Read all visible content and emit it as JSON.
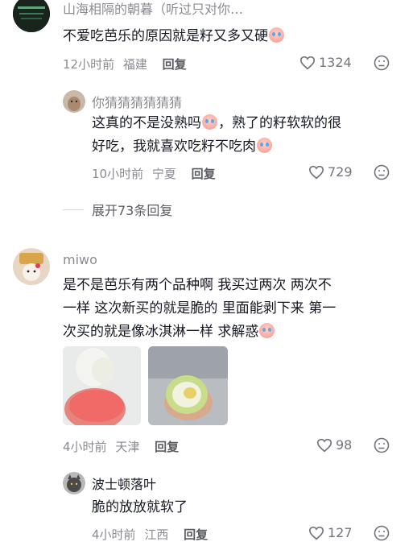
{
  "comments": [
    {
      "name": "山海相隔的朝暮（听过只对你…",
      "text_parts": [
        "不爱吃芭乐的原因就是籽又多又硬"
      ],
      "time": "12小时前",
      "location": "福建",
      "reply_label": "回复",
      "likes": "1324"
    },
    {
      "name": "你猜猜猜猜猜猜",
      "text_line1a": "这真的不是没熟吗",
      "text_line1b": "，熟了的籽软软的很",
      "text_line2": "好吃，我就喜欢吃籽不吃肉",
      "time": "10小时前",
      "location": "宁夏",
      "reply_label": "回复",
      "likes": "729"
    },
    {
      "name": "miwo",
      "text_line1": "是不是芭乐有两个品种啊 我买过两次 两次不",
      "text_line2": "一样 这次新买的就是脆的 里面能剥下来 第一",
      "text_line3": "次买的就是像冰淇淋一样 求解惑",
      "time": "4小时前",
      "location": "天津",
      "reply_label": "回复",
      "likes": "98"
    },
    {
      "name": "波士顿落叶",
      "text": "脆的放放就软了",
      "time": "4小时前",
      "location": "江西",
      "reply_label": "回复",
      "likes": "127"
    }
  ],
  "expand_label": "展开73条回复",
  "colors": {
    "muted": "#8a8b91",
    "text": "#161823"
  }
}
